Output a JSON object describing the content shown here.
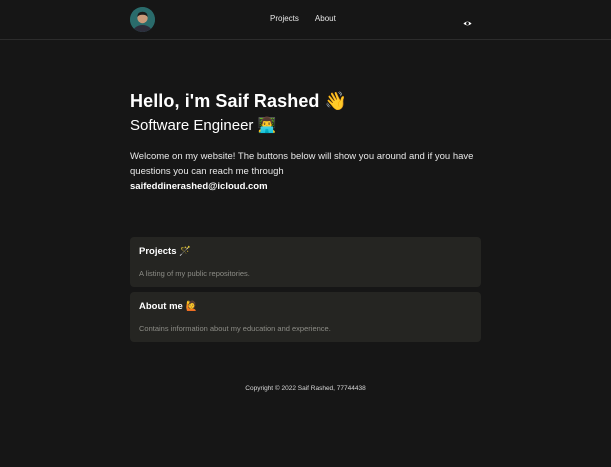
{
  "header": {
    "nav": [
      "Projects",
      "About"
    ]
  },
  "hero": {
    "title": "Hello, i'm Saif Rashed 👋",
    "subtitle": "Software Engineer 👨‍💻",
    "intro": "Welcome on my website! The buttons below will show you around and if you have questions you can reach me through",
    "email": "saifeddinerashed@icloud.com"
  },
  "cards": [
    {
      "title": "Projects 🪄",
      "description": "A listing of my public repositories."
    },
    {
      "title": "About me 🙋",
      "description": "Contains information about my education and experience."
    }
  ],
  "footer": {
    "copyright": "Copyright © 2022 Saif Rashed, 77744438"
  },
  "colors": {
    "background": "#161616",
    "card": "#252522",
    "muted_text": "#8c8c86"
  },
  "icons": {
    "theme_toggle": "eye-icon"
  }
}
